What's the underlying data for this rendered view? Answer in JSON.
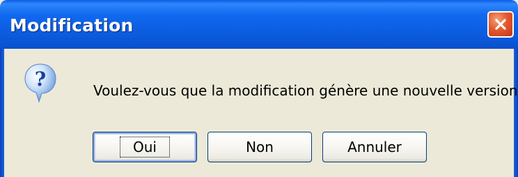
{
  "window": {
    "title": "Modification",
    "close_icon": "close-icon"
  },
  "dialog": {
    "icon": "question-icon",
    "message": "Voulez-vous que la modification génère une nouvelle version ?"
  },
  "buttons": {
    "yes": "Oui",
    "no": "Non",
    "cancel": "Annuler"
  },
  "colors": {
    "titlebar": "#0a5ee8",
    "close_button": "#e6582d",
    "body": "#ece9d8",
    "button_border": "#003c74"
  }
}
